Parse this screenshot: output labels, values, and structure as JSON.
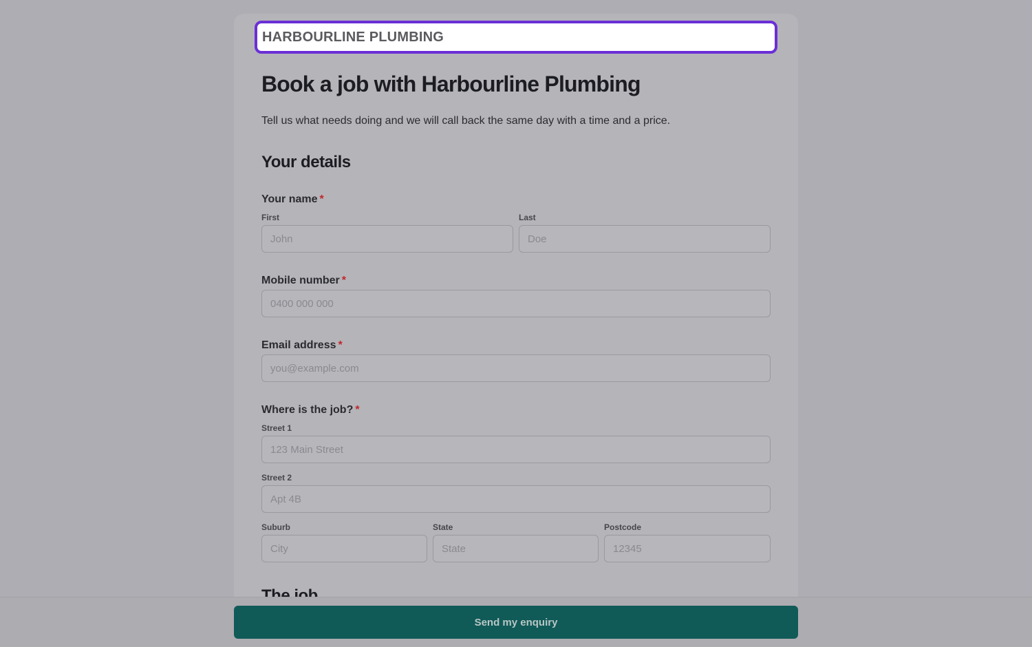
{
  "brand": {
    "name": "HARBOURLINE PLUMBING"
  },
  "header": {
    "title": "Book a job with Harbourline Plumbing",
    "intro": "Tell us what needs doing and we will call back the same day with a time and a price."
  },
  "details": {
    "section_title": "Your details",
    "name": {
      "label": "Your name",
      "required_mark": "*",
      "first_label": "First",
      "first_placeholder": "John",
      "last_label": "Last",
      "last_placeholder": "Doe"
    },
    "mobile": {
      "label": "Mobile number",
      "required_mark": "*",
      "placeholder": "0400 000 000"
    },
    "email": {
      "label": "Email address",
      "required_mark": "*",
      "placeholder": "you@example.com"
    },
    "address": {
      "label": "Where is the job?",
      "required_mark": "*",
      "street1_label": "Street 1",
      "street1_placeholder": "123 Main Street",
      "street2_label": "Street 2",
      "street2_placeholder": "Apt 4B",
      "suburb_label": "Suburb",
      "suburb_placeholder": "City",
      "state_label": "State",
      "state_placeholder": "State",
      "postcode_label": "Postcode",
      "postcode_placeholder": "12345"
    }
  },
  "job": {
    "section_title": "The job"
  },
  "footer": {
    "submit_label": "Send my enquiry"
  },
  "colors": {
    "accent_outline": "#6a2fd6",
    "submit_bg": "#105a58",
    "required": "#c0282d"
  }
}
